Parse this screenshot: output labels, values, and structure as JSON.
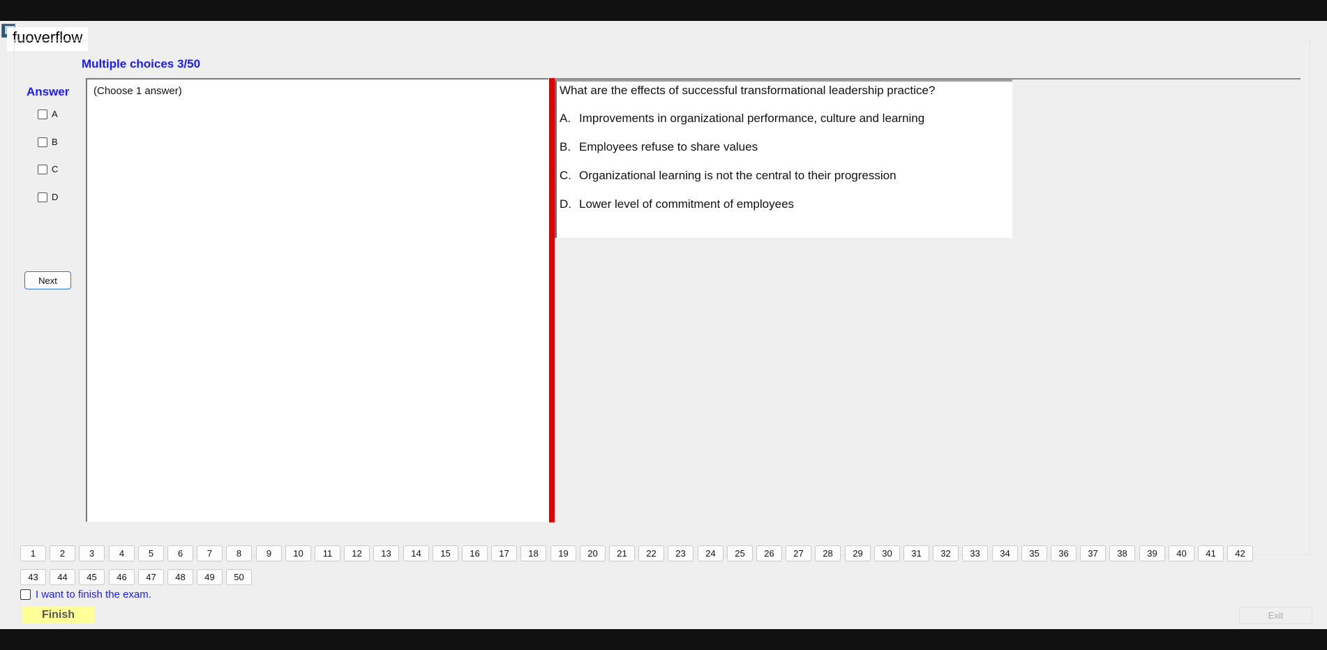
{
  "window": {
    "title": "fuoverflow",
    "app_icon": "application-icon"
  },
  "exam": {
    "heading": "Multiple choices 3/50",
    "answer_label": "Answer",
    "answer_options": [
      "A",
      "B",
      "C",
      "D"
    ],
    "next_label": "Next",
    "choose_hint": "(Choose 1 answer)"
  },
  "question": {
    "text": "What are the effects of successful transformational leadership practice?",
    "options": [
      {
        "letter": "A.",
        "text": "Improvements in organizational performance, culture and learning"
      },
      {
        "letter": "B.",
        "text": "Employees refuse to share values"
      },
      {
        "letter": "C.",
        "text": "Organizational learning is not the central to their progression"
      },
      {
        "letter": "D.",
        "text": "Lower level of commitment of employees"
      }
    ]
  },
  "question_nav": {
    "numbers": [
      "1",
      "2",
      "3",
      "4",
      "5",
      "6",
      "7",
      "8",
      "9",
      "10",
      "11",
      "12",
      "13",
      "14",
      "15",
      "16",
      "17",
      "18",
      "19",
      "20",
      "21",
      "22",
      "23",
      "24",
      "25",
      "26",
      "27",
      "28",
      "29",
      "30",
      "31",
      "32",
      "33",
      "34",
      "35",
      "36",
      "37",
      "38",
      "39",
      "40",
      "41",
      "42",
      "43",
      "44",
      "45",
      "46",
      "47",
      "48",
      "49",
      "50"
    ]
  },
  "footer": {
    "finish_check_label": "I want to finish the exam.",
    "finish_label": "Finish",
    "exit_label": "Exit"
  },
  "colors": {
    "accent_blue": "#1a1aff",
    "splitter_red": "#e00000",
    "finish_yellow": "#ffff99"
  }
}
